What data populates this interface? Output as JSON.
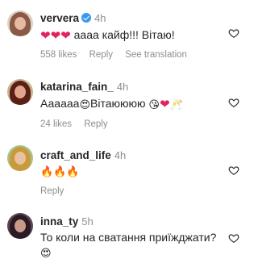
{
  "comments": [
    {
      "username": "ververa",
      "verified": true,
      "time": "4h",
      "text": "аааа кайф!!! Вітаю!",
      "emoji_prefix": [
        "heart",
        "heart",
        "heart"
      ],
      "likes": "558 likes",
      "reply": "Reply",
      "translate": "See translation",
      "avatar_color": "#b8877a"
    },
    {
      "username": "katarina_fain_",
      "verified": false,
      "time": "4h",
      "text_part1": "Аааааа",
      "text_part2": "Вітаюююю",
      "likes": "24 likes",
      "reply": "Reply",
      "avatar_color": "#6b2a1f"
    },
    {
      "username": "craft_and_life",
      "verified": false,
      "time": "4h",
      "emojis": [
        "fire",
        "fire",
        "fire"
      ],
      "likes": "",
      "reply": "Reply",
      "avatar_color": "#9c7a3c"
    },
    {
      "username": "inna_ty",
      "verified": false,
      "time": "5h",
      "text": "То коли на сватання приїжджати?",
      "avatar_color": "#3b2a36"
    }
  ]
}
